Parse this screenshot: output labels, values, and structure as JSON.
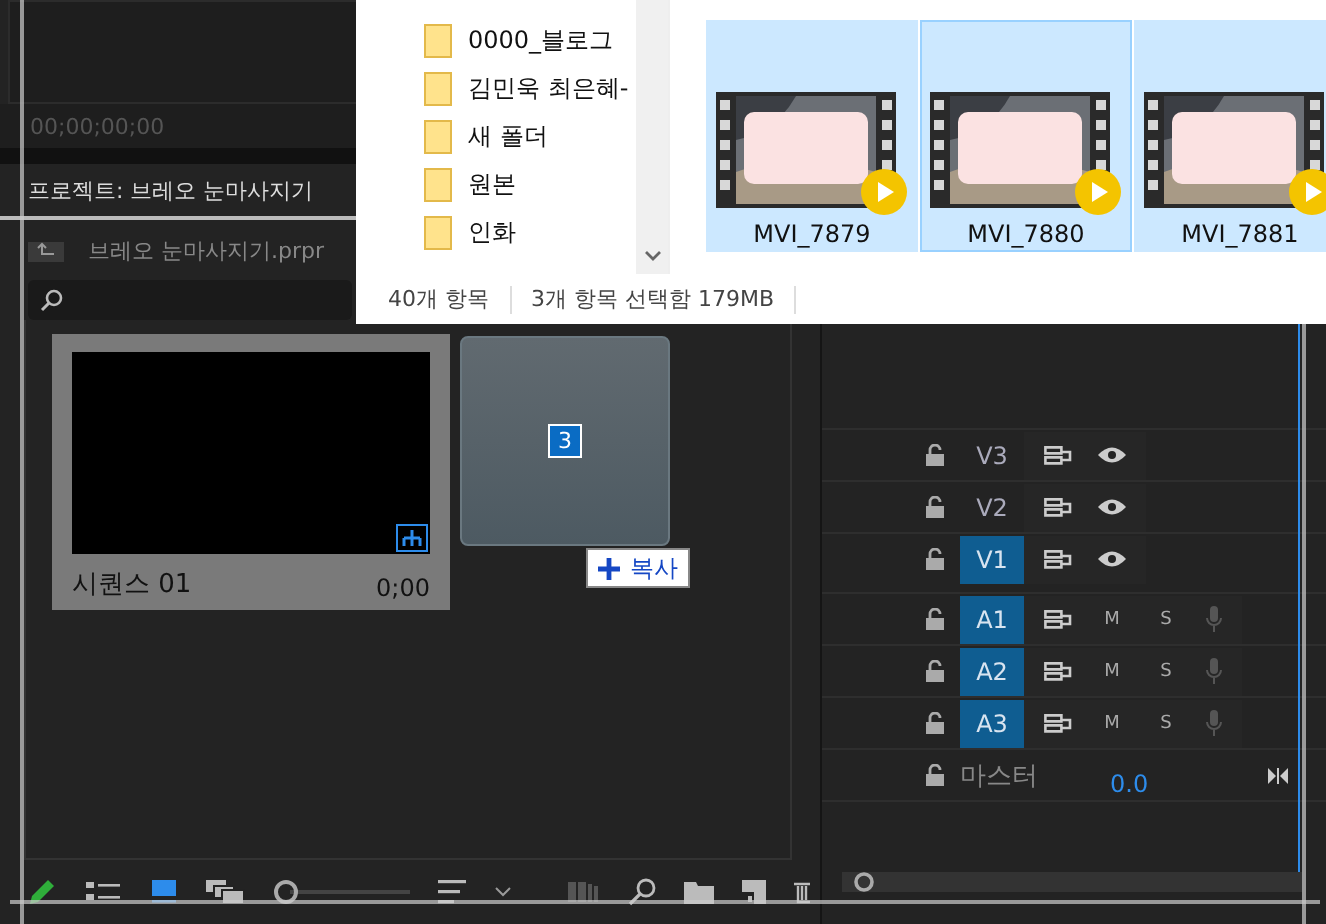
{
  "source_monitor": {
    "timecode": "00;00;00;00"
  },
  "project": {
    "tab": "프로젝트: 브레오 눈마사지기",
    "file": "브레오 눈마사지기.prpr",
    "items": [
      {
        "name": "시퀀스 01",
        "duration": "0;00",
        "selected": true
      }
    ],
    "view_modes": [
      {
        "kind": "list",
        "selected": false
      },
      {
        "kind": "icon",
        "selected": true
      },
      {
        "kind": "freeform",
        "selected": false
      }
    ],
    "zoom": {
      "level": 0
    }
  },
  "drag": {
    "count": "3",
    "action": "복사"
  },
  "timeline": {
    "tracks": [
      {
        "kind": "video",
        "name": "V3",
        "targeted": false
      },
      {
        "kind": "video",
        "name": "V2",
        "targeted": false
      },
      {
        "kind": "video",
        "name": "V1",
        "targeted": true
      },
      {
        "kind": "audio",
        "name": "A1",
        "targeted": true,
        "mute": "M",
        "solo": "S"
      },
      {
        "kind": "audio",
        "name": "A2",
        "targeted": true,
        "mute": "M",
        "solo": "S"
      },
      {
        "kind": "audio",
        "name": "A3",
        "targeted": true,
        "mute": "M",
        "solo": "S"
      }
    ],
    "master": {
      "label": "마스터",
      "value": "0.0"
    }
  },
  "explorer": {
    "folders": [
      {
        "label": "0000_블로그"
      },
      {
        "label": "김민욱 최은혜-"
      },
      {
        "label": "새 폴더"
      },
      {
        "label": "원본"
      },
      {
        "label": "인화"
      }
    ],
    "files": [
      {
        "name": "MVI_7879",
        "selected": true
      },
      {
        "name": "MVI_7880",
        "selected": true
      },
      {
        "name": "MVI_7881",
        "selected": true
      }
    ],
    "status": {
      "count": "40개 항목",
      "selection": "3개 항목 선택함 179MB"
    }
  }
}
